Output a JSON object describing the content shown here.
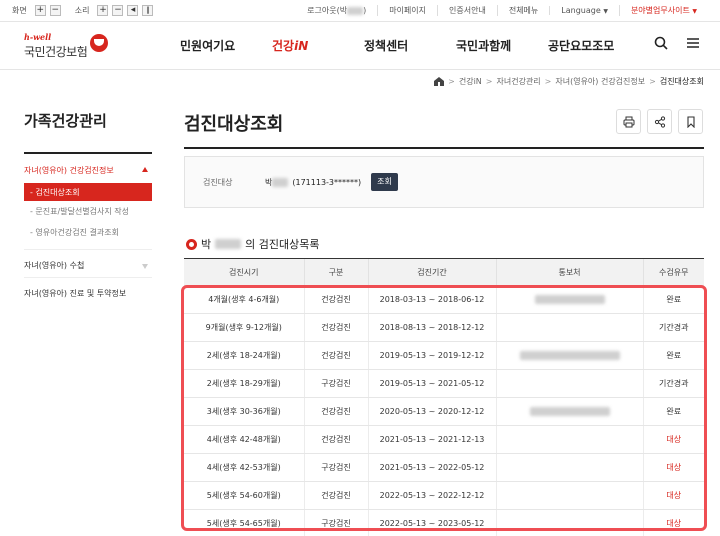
{
  "utility": {
    "screen_label": "화면",
    "sound_label": "소리",
    "plus": "+",
    "minus": "−",
    "login_prefix": "로그아웃(박",
    "login_suffix": ")",
    "mypage": "마이페이지",
    "cert": "인증서안내",
    "allmenu": "전체메뉴",
    "language": "Language",
    "site": "분야별업무사이트"
  },
  "header": {
    "logo_sub": "h-well",
    "logo_main": "국민건강보험",
    "nav": [
      "민원여기요",
      "건강",
      "정책센터",
      "국민과함께",
      "공단요모조모"
    ],
    "nav_active_suffix": "iN"
  },
  "breadcrumb": [
    "건강iN",
    "자녀건강관리",
    "자녀(영유아) 건강검진정보",
    "검진대상조회"
  ],
  "sidebar": {
    "title": "가족건강관리",
    "section": "자녀(영유아) 건강검진정보",
    "sub_active": "- 검진대상조회",
    "subs": [
      "- 문진표/발달선별검사지 작성",
      "- 영유아건강검진 결과조회"
    ],
    "items": [
      "자녀(영유아) 수첩",
      "자녀(영유아) 진료 및 투약정보"
    ]
  },
  "main": {
    "title": "검진대상조회",
    "target_label": "검진대상",
    "target_name": "박",
    "target_id": "(171113-3******)",
    "query_btn": "조회",
    "list_prefix": "박",
    "list_suffix": "의 검진대상목록"
  },
  "table": {
    "headers": [
      "검진시기",
      "구분",
      "검진기간",
      "통보처",
      "수검유무"
    ],
    "rows": [
      {
        "period": "4개월(생후 4-6개월)",
        "type": "건강검진",
        "range": "2018-03-13 ~ 2018-06-12",
        "status": "완료"
      },
      {
        "period": "9개월(생후 9-12개월)",
        "type": "건강검진",
        "range": "2018-08-13 ~ 2018-12-12",
        "status": "기간경과"
      },
      {
        "period": "2세(생후 18-24개월)",
        "type": "건강검진",
        "range": "2019-05-13 ~ 2019-12-12",
        "status": "완료"
      },
      {
        "period": "2세(생후 18-29개월)",
        "type": "구강검진",
        "range": "2019-05-13 ~ 2021-05-12",
        "status": "기간경과"
      },
      {
        "period": "3세(생후 30-36개월)",
        "type": "건강검진",
        "range": "2020-05-13 ~ 2020-12-12",
        "status": "완료"
      },
      {
        "period": "4세(생후 42-48개월)",
        "type": "건강검진",
        "range": "2021-05-13 ~ 2021-12-13",
        "status": "대상"
      },
      {
        "period": "4세(생후 42-53개월)",
        "type": "구강검진",
        "range": "2021-05-13 ~ 2022-05-12",
        "status": "대상"
      },
      {
        "period": "5세(생후 54-60개월)",
        "type": "건강검진",
        "range": "2022-05-13 ~ 2022-12-12",
        "status": "대상"
      },
      {
        "period": "5세(생후 54-65개월)",
        "type": "구강검진",
        "range": "2022-05-13 ~ 2023-05-12",
        "status": "대상"
      }
    ]
  },
  "colors": {
    "accent": "#d7261e",
    "highlight": "#ef4e53",
    "button_dark": "#2f3a4c"
  }
}
